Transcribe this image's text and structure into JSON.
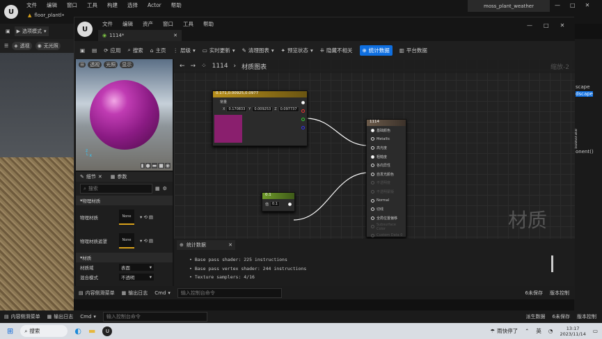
{
  "outer": {
    "menu": [
      "文件",
      "编辑",
      "窗口",
      "工具",
      "构建",
      "选择",
      "Actor",
      "帮助"
    ],
    "tab_label": "floor_plantl•",
    "project": "moss_plant_weather",
    "select_mode": "选项模式",
    "view_perspective": "透视",
    "view_lit": "无光照",
    "status": {
      "content_drawer": "内容侧滑菜单",
      "output_log": "输出日志",
      "cmd": "Cmd",
      "console_placeholder": "输入控制台命令",
      "derived_data": "派生数据",
      "unsaved": "6未保存",
      "source_control": "版本控制"
    },
    "right_panel_labels": [
      "scape",
      "dscape",
      "onent()",
      "Substrate"
    ]
  },
  "material_editor": {
    "menu": [
      "文件",
      "编辑",
      "资产",
      "窗口",
      "工具",
      "帮助"
    ],
    "tab_label": "1114*",
    "toolbar": {
      "apply": "应用",
      "search": "搜索",
      "home": "主页",
      "hierarchy": "层级",
      "live_update": "实时更新",
      "clean_graph": "清理图表",
      "preview_state": "预览状态",
      "hide_unrelated": "隐藏不相关",
      "stats": "统计数据",
      "platform_stats": "平台数据"
    },
    "breadcrumb": {
      "asset": "1114",
      "graph": "材质图表"
    },
    "zoom": "缩放-2",
    "watermark": "材质",
    "preview": {
      "perspective": "透视",
      "lit": "光照",
      "show": "显示"
    },
    "details": {
      "tab_details": "细节",
      "tab_params": "参数",
      "search_placeholder": "搜索",
      "section_physical": "物理材质",
      "phys_mat_label": "物理材质",
      "phys_mat_value": "None",
      "phys_mask_label": "物理材质遮罩",
      "phys_mask_value": "None",
      "section_material": "材质",
      "domain_label": "材质域",
      "domain_value": "表面",
      "blend_label": "混合模式",
      "blend_value": "不透明"
    },
    "nodes": {
      "constant3": {
        "title": "0.171,0.00925,0.0977",
        "label": "常量",
        "r": "0.170833",
        "g": "0.009253",
        "b": "0.097737",
        "r_lbl": "X",
        "g_lbl": "Y",
        "b_lbl": "Z"
      },
      "result": {
        "title": "1114",
        "pins": [
          "基础颜色",
          "Metallic",
          "高光度",
          "粗糙度",
          "各向异性",
          "自发光颜色",
          "不透明度",
          "不透明蒙版",
          "Normal",
          "切线",
          "全局位置偏移",
          "Subsurface Color",
          "Custom Data 0"
        ]
      },
      "scalar": {
        "title": "0.1",
        "label": "值",
        "value": "0.1"
      }
    },
    "stats": {
      "tab_label": "统计数据",
      "lines": [
        "Base pass shader: 225 instructions",
        "Base pass vertex shader: 244 instructions",
        "Texture samplers: 4/16"
      ]
    },
    "status": {
      "content_drawer": "内容侧滑菜单",
      "output_log": "输出日志",
      "cmd": "Cmd",
      "console_placeholder": "输入控制台命令",
      "unsaved": "6未保存",
      "source_control": "版本控制"
    }
  },
  "taskbar": {
    "search": "搜索",
    "weather": "雨快停了",
    "ime": "英",
    "time": "13:17",
    "date": "2023/11/14"
  }
}
